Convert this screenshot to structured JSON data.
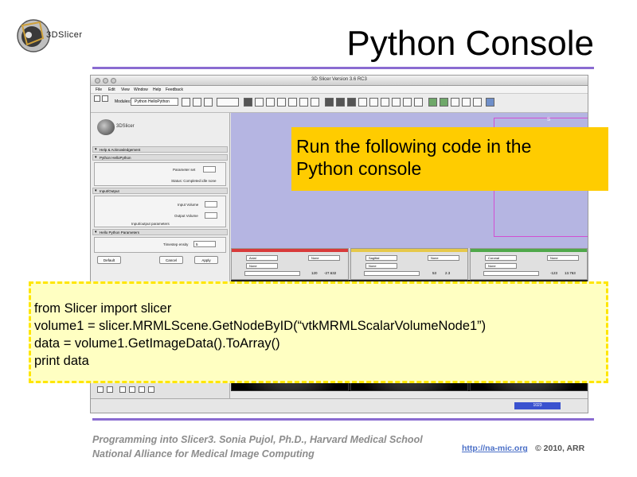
{
  "slide": {
    "logo_text": "3DSlicer",
    "title": "Python Console"
  },
  "app": {
    "window_title": "3D Slicer Version 3.6 RC3",
    "menu": [
      "File",
      "Edit",
      "View",
      "Window",
      "Help",
      "Feedback"
    ],
    "modules_label": "Modules:",
    "module_selected": "Python HelloPython",
    "panel_logo_text": "3DSlicer",
    "sections": {
      "help": "Help & Acknowledgement",
      "module": "Python HelloPython",
      "io": "Input/Output",
      "params": "Hello Python Parameters"
    },
    "fields": {
      "parameter_set": "Parameter set",
      "status": "Status: Completed  idle  none",
      "input_volume": "Input Volume",
      "output_volume": "Output Volume",
      "io_params": "Input/output parameters",
      "timestep": "Timestep ensity",
      "timestep_value": "5"
    },
    "buttons": {
      "default": "Default",
      "cancel": "Cancel",
      "apply": "Apply"
    },
    "slices": [
      {
        "orientation": "Axial",
        "value": "120",
        "offset": "-27.632",
        "color": "#d83a3a"
      },
      {
        "orientation": "Sagittal",
        "value": "53",
        "offset": "2.3",
        "color": "#e6c84a"
      },
      {
        "orientation": "Coronal",
        "value": "-123",
        "offset": "13.763",
        "color": "#4fa84a"
      }
    ],
    "slice_none": "None",
    "s_label": "S",
    "status_value": "1023"
  },
  "callout": {
    "text_line1": "Run the following code in the",
    "text_line2": "Python console"
  },
  "code": {
    "line1": "from Slicer import slicer",
    "line2": "volume1 = slicer.MRMLScene.GetNodeByID(“vtkMRMLScalarVolumeNode1”)",
    "line3": "data = volume1.GetImageData().ToArray()",
    "line4": "print data"
  },
  "footer": {
    "line1": "Programming into Slicer3. Sonia Pujol, Ph.D., Harvard Medical School",
    "line2": "National Alliance for Medical Image Computing",
    "link": "http://na-mic.org",
    "copyright": "© 2010, ARR"
  }
}
